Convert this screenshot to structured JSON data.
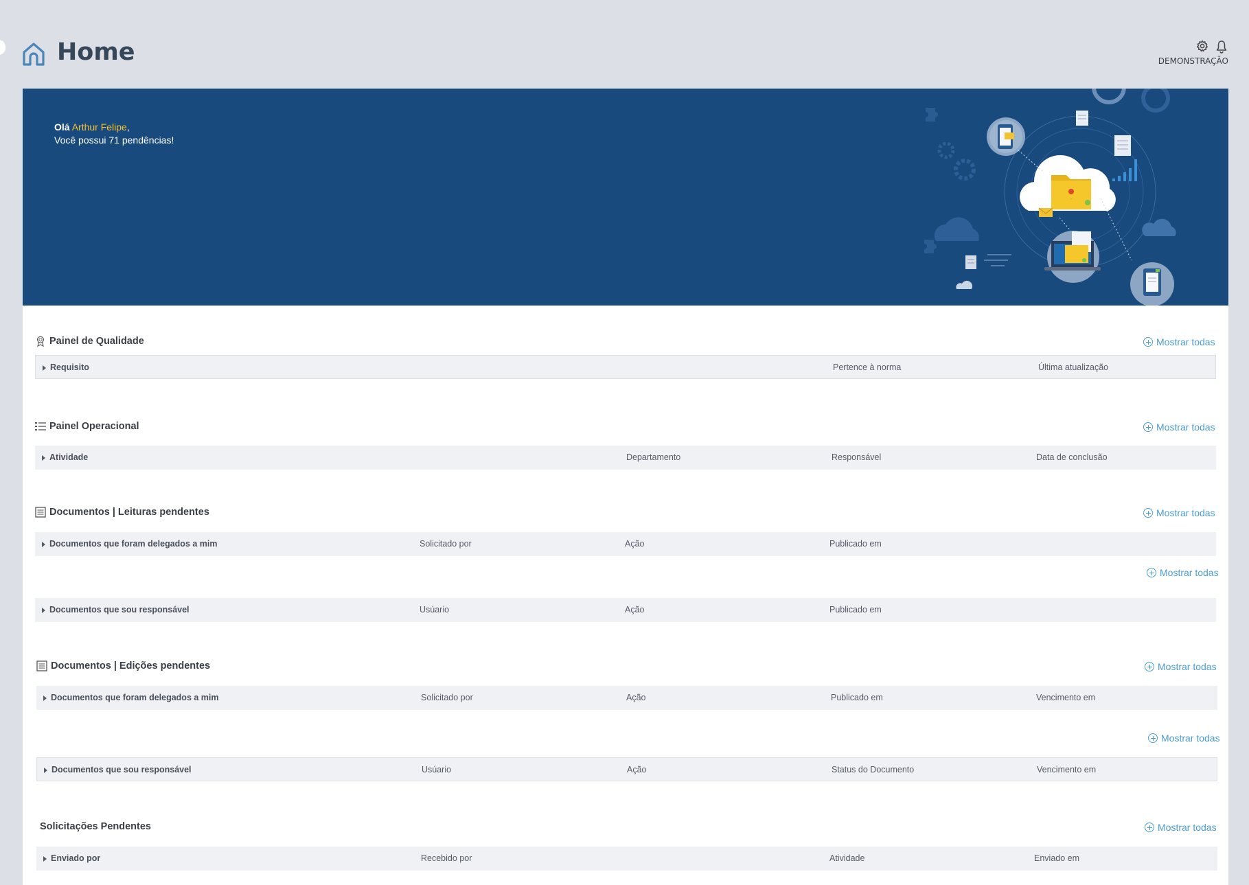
{
  "header": {
    "title": "Home",
    "company": "DEMONSTRAÇÃO",
    "icons": [
      "home-icon",
      "gear-icon",
      "bell-icon"
    ]
  },
  "banner": {
    "hello": "Olá",
    "user_name": "Arthur Felipe",
    "comma": ",",
    "pending_message": "Você possui 71 pendências!",
    "colors": {
      "background": "#184a7e",
      "highlight": "#f2c233"
    }
  },
  "show_all_label": "Mostrar todas",
  "sections": {
    "quality": {
      "title": "Painel de Qualidade",
      "columns": [
        "Requisito",
        "Pertence à norma",
        "Última atualização"
      ]
    },
    "operational": {
      "title": "Painel Operacional",
      "columns": [
        "Atividade",
        "Departamento",
        "Responsável",
        "Data de conclusão"
      ]
    },
    "readings": {
      "title": "Documentos | Leituras pendentes",
      "delegated_columns": [
        "Documentos que foram delegados a mim",
        "Solicitado por",
        "Ação",
        "Publicado em"
      ],
      "responsible_columns": [
        "Documentos que sou responsável",
        "Usúario",
        "Ação",
        "Publicado em"
      ]
    },
    "editions": {
      "title": "Documentos | Edições pendentes",
      "delegated_columns": [
        "Documentos que foram delegados a mim",
        "Solicitado por",
        "Ação",
        "Publicado em",
        "Vencimento em"
      ],
      "responsible_columns": [
        "Documentos que sou responsável",
        "Usúario",
        "Ação",
        "Status do Documento",
        "Vencimento em"
      ]
    },
    "requests": {
      "title": "Solicitações Pendentes",
      "columns": [
        "Enviado por",
        "Recebido por",
        "Atividade",
        "Enviado em"
      ]
    }
  },
  "accent_color": "#4a9dd6"
}
